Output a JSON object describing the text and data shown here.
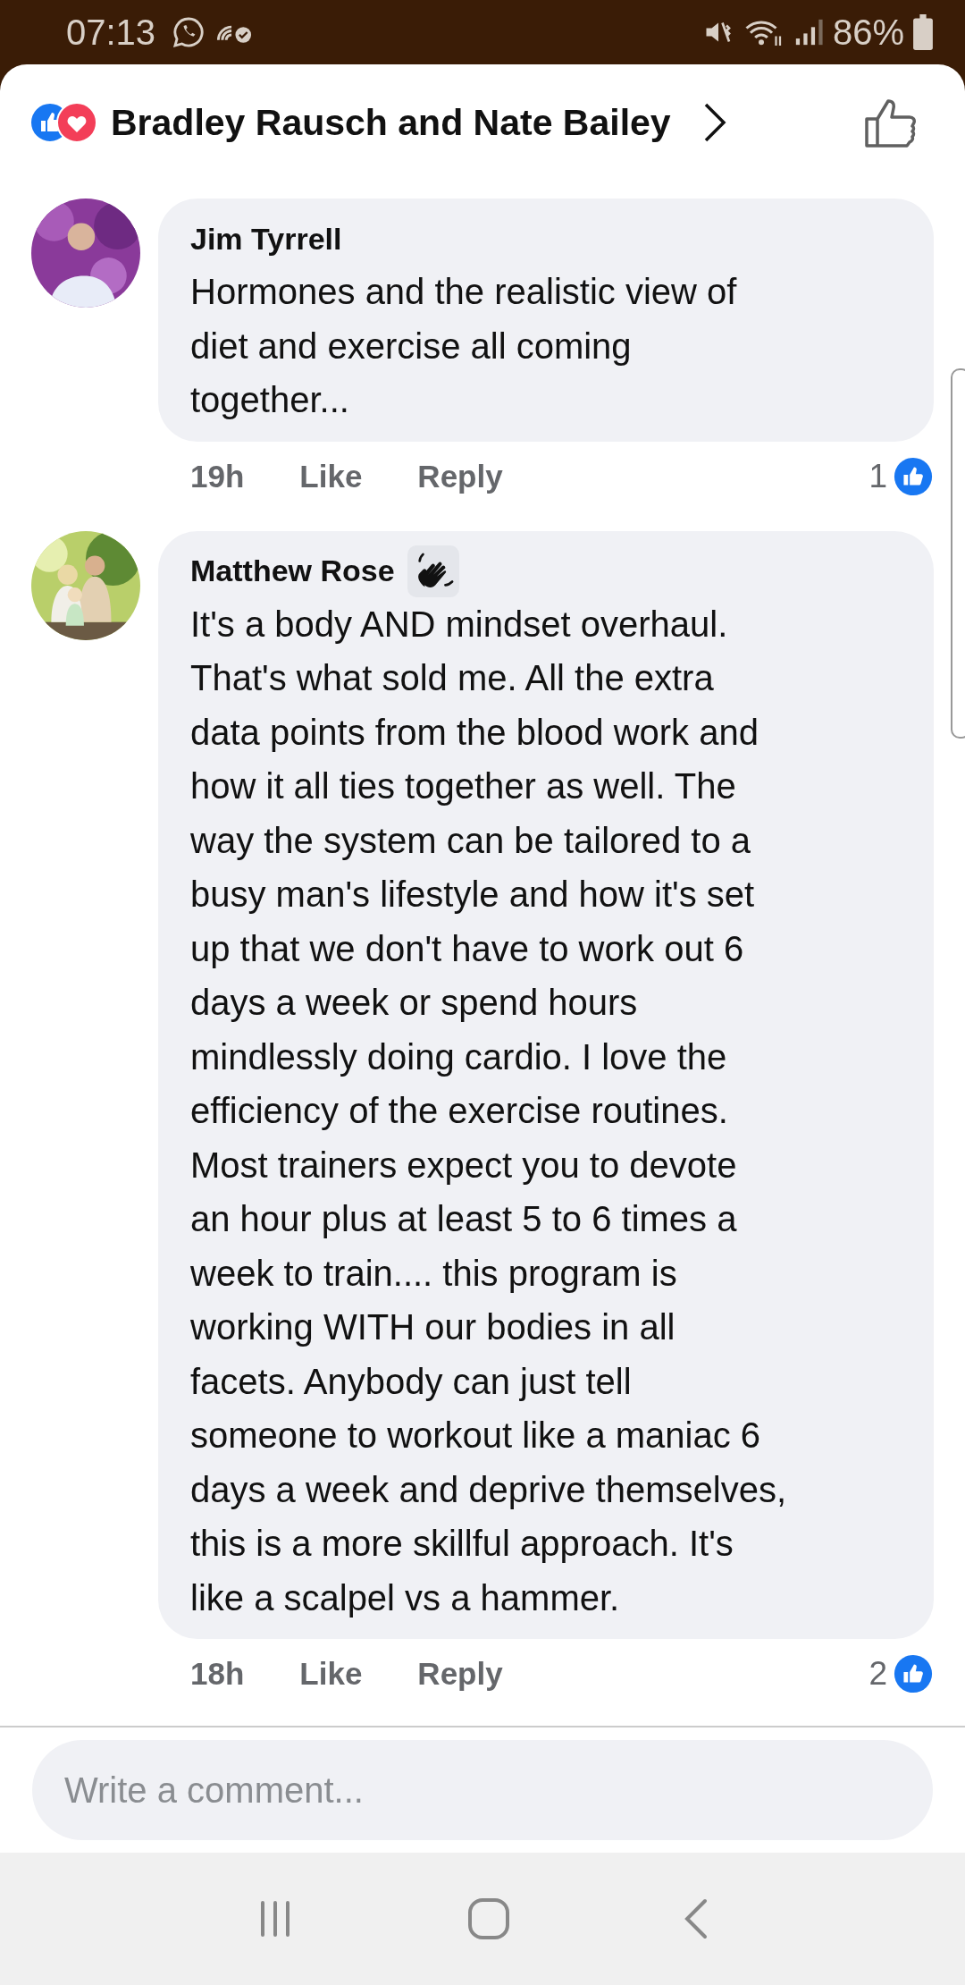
{
  "status_bar": {
    "time": "07:13",
    "battery": "86%"
  },
  "header": {
    "title": "Bradley Rausch and Nate Bailey"
  },
  "comments": [
    {
      "author": "Jim Tyrrell",
      "wave_badge": false,
      "text": "Hormones and the realistic view of\ndiet and exercise all coming\ntogether...",
      "time": "19h",
      "actions": [
        "Like",
        "Reply"
      ],
      "reaction_count": "1"
    },
    {
      "author": "Matthew Rose",
      "wave_badge": true,
      "text": "It's a body AND mindset overhaul.\nThat's what sold me. All the extra\ndata points from the blood work and\nhow it all ties together as well.  The\nway the system can be tailored to a\nbusy man's lifestyle and how it's set\nup that we don't have to work out 6\ndays a week or spend hours\nmindlessly doing cardio. I love the\nefficiency of the exercise routines.\nMost trainers expect you to devote\nan hour plus at least 5 to 6 times a\nweek to train.... this program is\nworking WITH our bodies in all\nfacets. Anybody can just tell\nsomeone to workout like a maniac 6\ndays a week and deprive themselves,\nthis is a more skillful approach. It's\nlike a scalpel vs a hammer.",
      "time": "18h",
      "actions": [
        "Like",
        "Reply"
      ],
      "reaction_count": "2"
    }
  ],
  "composer": {
    "placeholder": "Write a comment..."
  }
}
